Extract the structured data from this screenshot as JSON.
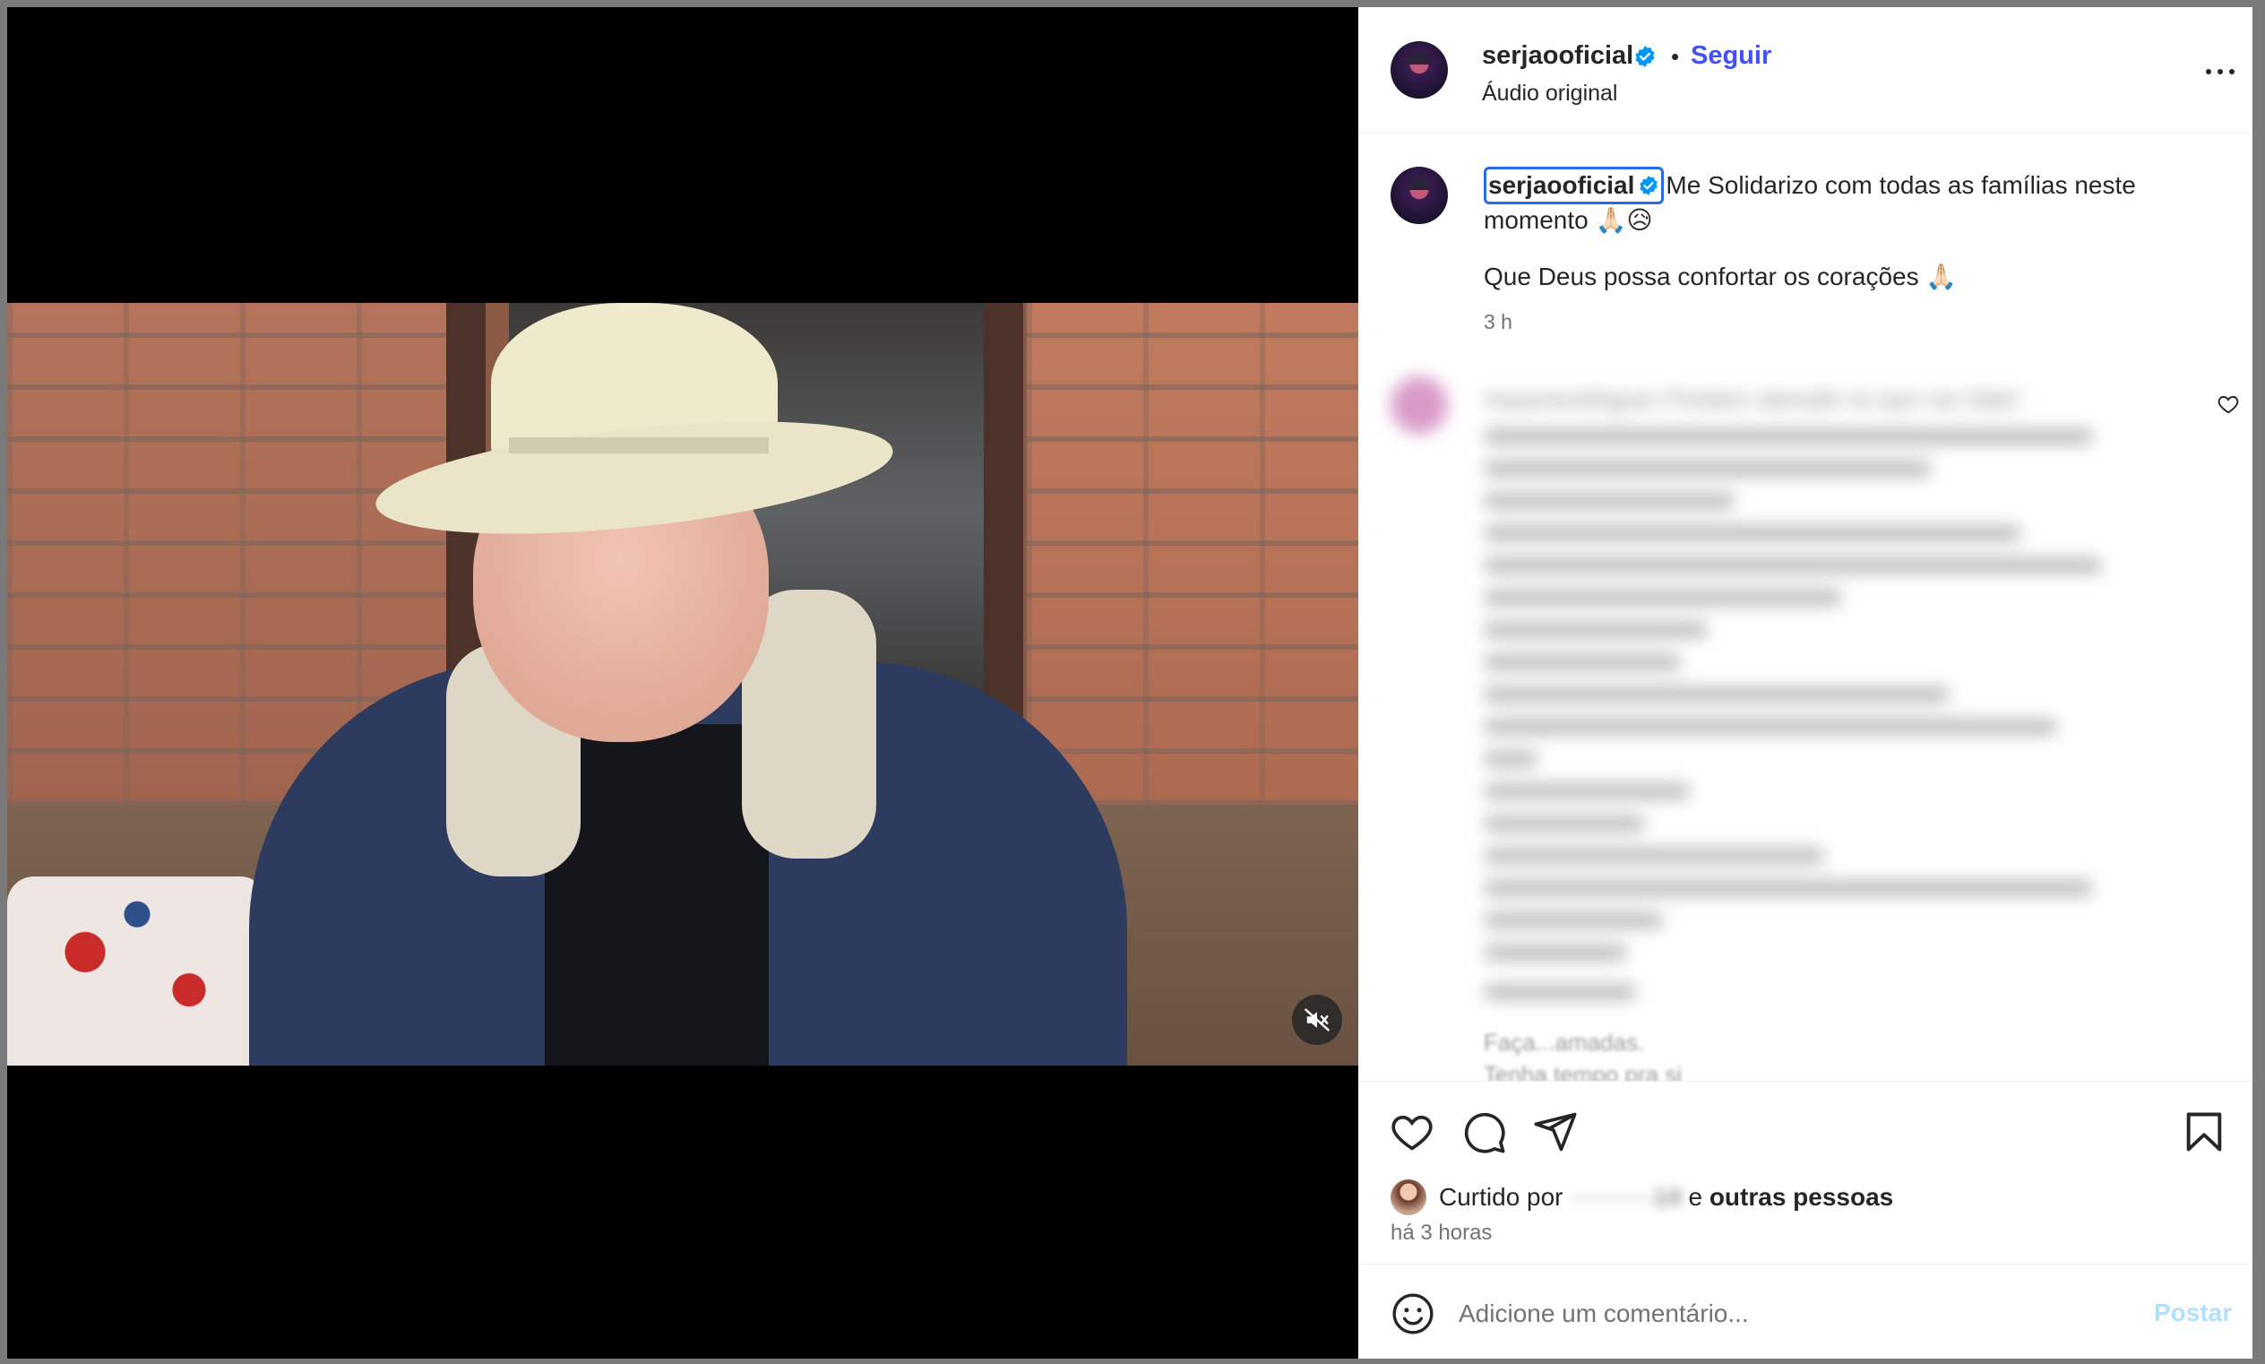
{
  "post": {
    "username": "serjaooficial",
    "follow_label": "Seguir",
    "separator": "•",
    "audio_label": "Áudio original",
    "caption": "Me Solidarizo com todas as famílias neste momento 🙏🏻😥",
    "caption_line2": "Que Deus possa confortar os corações 🙏🏻",
    "caption_time": "3 h"
  },
  "comment_preview": {
    "text": "mayararodriguez Prestem atenção no que vou falar!",
    "partial_lines": [
      "Faça...amadas.",
      "Tenha tempo pra si"
    ]
  },
  "likes": {
    "prefix": "Curtido por",
    "blurred_name": "··········14",
    "conjunction": "e",
    "others": "outras pessoas",
    "ago": "há 3 horas"
  },
  "composer": {
    "placeholder": "Adicione um comentário...",
    "post_label": "Postar"
  },
  "colors": {
    "accent": "#4150f7",
    "verified": "#0095f6",
    "post_disabled": "#b2dffc"
  },
  "icons": [
    "mute-icon",
    "more-icon",
    "verified-icon",
    "heart-icon",
    "comment-icon",
    "share-icon",
    "bookmark-icon",
    "emoji-icon"
  ]
}
